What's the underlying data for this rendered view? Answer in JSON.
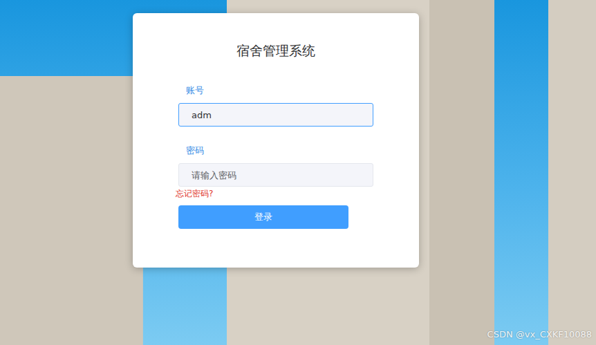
{
  "window": {
    "title": "宿舍管理系统"
  },
  "fields": [
    {
      "label": "账号",
      "value": "adm",
      "placeholder": "",
      "focused": true
    },
    {
      "label": "密码",
      "value": "",
      "placeholder": "请输入密码",
      "focused": false
    }
  ],
  "forgot_link": "忘记密码?",
  "login_button": "登录",
  "watermark": "CSDN @vx_CXKF10088"
}
